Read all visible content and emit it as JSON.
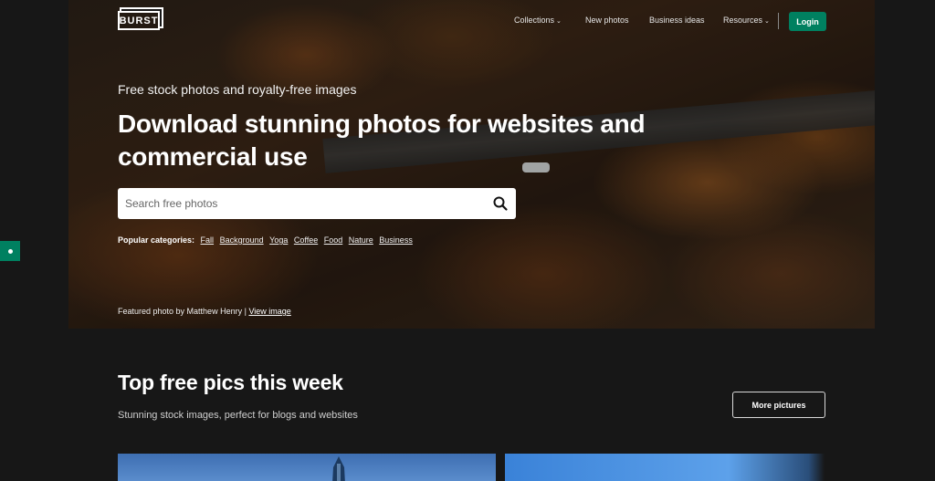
{
  "header": {
    "logo": "BURST",
    "nav": [
      {
        "label": "Collections",
        "dropdown": true
      },
      {
        "label": "New photos",
        "dropdown": false
      },
      {
        "label": "Business ideas",
        "dropdown": false
      },
      {
        "label": "Resources",
        "dropdown": true
      }
    ],
    "login_label": "Login"
  },
  "hero": {
    "subtitle": "Free stock photos and royalty-free images",
    "headline": "Download stunning photos for websites and commercial use",
    "search": {
      "placeholder": "Search free photos",
      "value": ""
    },
    "popular_label": "Popular categories:",
    "categories": [
      "Fall",
      "Background",
      "Yoga",
      "Coffee",
      "Food",
      "Nature",
      "Business"
    ],
    "credit_prefix": "Featured photo by Matthew Henry |",
    "credit_link": "View image"
  },
  "section": {
    "title": "Top free pics this week",
    "subtitle": "Stunning stock images, perfect for blogs and websites",
    "more_button": "More pictures"
  },
  "colors": {
    "accent": "#008060",
    "background": "#171717"
  },
  "icons": {
    "search": "search-icon",
    "dropdown": "chevron-down-icon",
    "side_tab": "feedback-icon"
  }
}
